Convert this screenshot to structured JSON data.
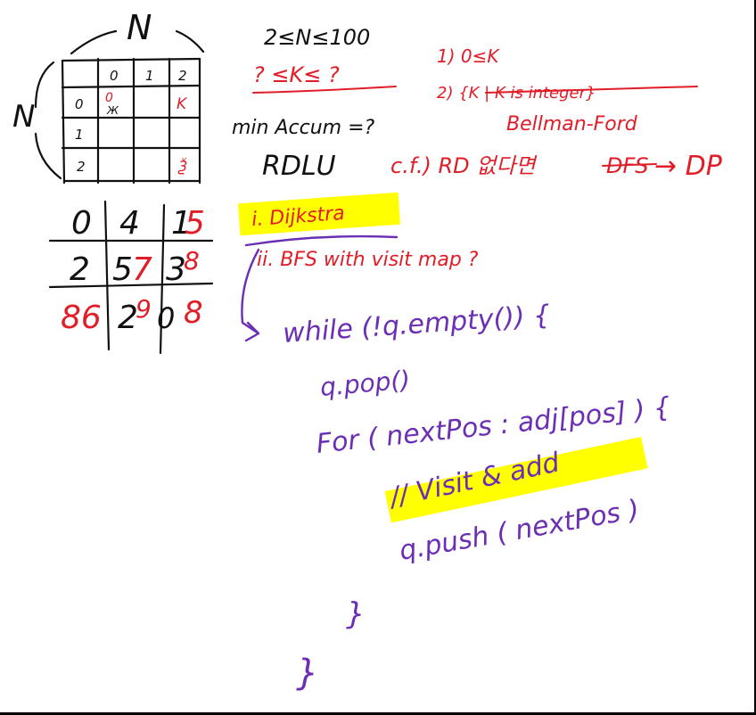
{
  "notes": {
    "grid_label_top": "N",
    "grid_label_left": "N",
    "grid_col_headers": [
      "0",
      "1",
      "2"
    ],
    "grid_row_headers": [
      "0",
      "1",
      "2"
    ],
    "grid_cell_start": "0",
    "grid_cell_start_sub": "Ж",
    "grid_cell_k": "K",
    "grid_cell_end": "Ѯ",
    "constraint_n": "2≤N≤100",
    "constraint_k": "? ≤K≤ ?",
    "min_accum": "min Accum =?",
    "directions": "RDLU",
    "k_note_1": "1)  0≤K",
    "k_note_2": "2)  {K | K is integer}",
    "bellman_ford": "Bellman-Ford",
    "cf_note_prefix": "c.f.) RD 없다면",
    "cf_note_dfs": "DFS",
    "cf_note_dp": "→ DP",
    "example_grid": {
      "rows": [
        [
          {
            "v": "0"
          },
          {
            "v": "4"
          },
          {
            "v": "1",
            "red": "5"
          }
        ],
        [
          {
            "v": "2"
          },
          {
            "v": "5",
            "red": "7"
          },
          {
            "v": "3",
            "red": "8"
          }
        ],
        [
          {
            "red": "86"
          },
          {
            "v": "2",
            "red": "9"
          },
          {
            "v": "0",
            "red": "8"
          }
        ]
      ]
    },
    "dijkstra": "i. Dijkstra",
    "bfs_title": "ii. BFS with visit map ?",
    "code": {
      "line_while": "while (!q.empty()) {",
      "line_pop": "q.pop()",
      "line_for": "For ( nextPos : adj[pos] ) {",
      "line_visit": "// Visit & add",
      "line_push": "q.push ( nextPos )",
      "line_close_inner": "}",
      "line_close_outer": "}"
    }
  },
  "colors": {
    "black_ink": "#111111",
    "red_ink": "#e11d28",
    "purple_ink": "#6b2fb3",
    "highlight": "#ffff00"
  }
}
